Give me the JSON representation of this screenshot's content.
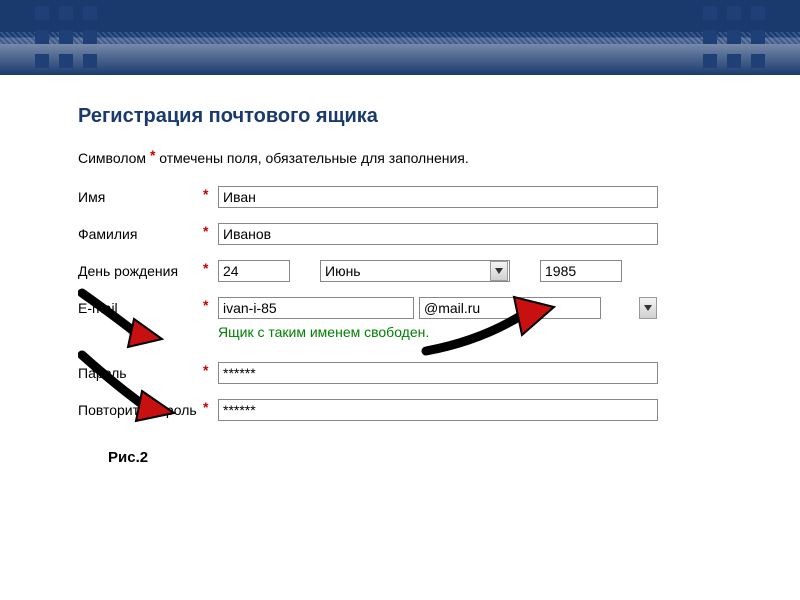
{
  "title": "Регистрация почтового ящика",
  "instruction": {
    "pre": "Символом ",
    "mark": "*",
    "post": " отмечены поля, обязательные для заполнения."
  },
  "labels": {
    "first_name": "Имя",
    "last_name": "Фамилия",
    "birthday": "День рождения",
    "email": "E-mail",
    "password": "Пароль",
    "password_repeat": "Повторите пароль"
  },
  "values": {
    "first_name": "Иван",
    "last_name": "Иванов",
    "day": "24",
    "month": "Июнь",
    "year": "1985",
    "login": "ivan-i-85",
    "domain": "@mail.ru",
    "password": "******",
    "password_repeat": "******"
  },
  "status": "Ящик с таким именем свободен.",
  "required_mark": "*",
  "caption": "Рис.2"
}
